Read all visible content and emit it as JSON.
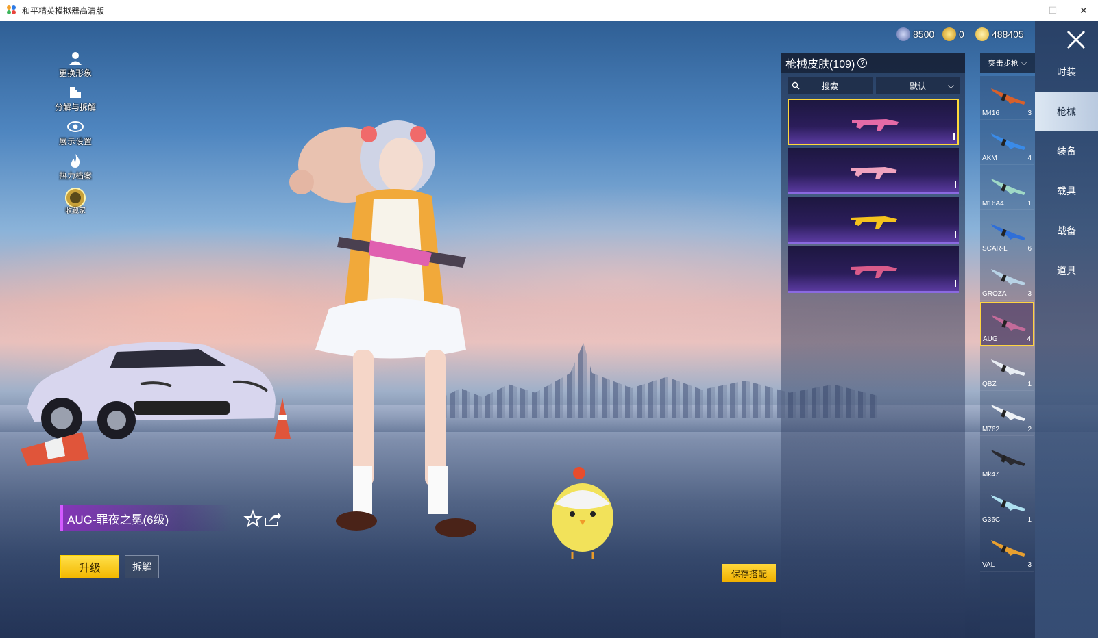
{
  "window": {
    "title": "和平精英模拟器高清版",
    "minimize_glyph": "—",
    "maximize_glyph": "☐",
    "close_glyph": "✕"
  },
  "currency": [
    {
      "icon": "globe-coin-icon",
      "value": "8500",
      "color": "#7c8cc8"
    },
    {
      "icon": "gold-token-icon",
      "value": "0",
      "color": "#f2c032"
    },
    {
      "icon": "diamond-coin-icon",
      "value": "488405",
      "color": "#f5d25a"
    }
  ],
  "left_menu": [
    {
      "icon": "avatar-icon",
      "label": "更换形象"
    },
    {
      "icon": "puzzle-icon",
      "label": "分解与拆解"
    },
    {
      "icon": "eye-icon",
      "label": "展示设置"
    },
    {
      "icon": "flame-icon",
      "label": "热力档案"
    },
    {
      "icon": "collector-badge-icon",
      "label": "收藏家"
    }
  ],
  "selected_skin": {
    "title": "AUG-罪夜之冕(6级)",
    "upgrade_label": "升级",
    "dismantle_label": "拆解",
    "save_label": "保存搭配"
  },
  "skin_panel": {
    "title": "枪械皮肤(109)",
    "help": "?",
    "search_placeholder": "搜索",
    "sort_label": "默认",
    "cards": [
      {
        "gun_color": "#e56aa6",
        "selected": true
      },
      {
        "gun_color": "#f0a3bf",
        "selected": false
      },
      {
        "gun_color": "#f5c31d",
        "selected": false
      },
      {
        "gun_color": "#d95b8a",
        "selected": false
      }
    ]
  },
  "weapon_category": "突击步枪",
  "weapons": [
    {
      "name": "M416",
      "count": "3",
      "gun_color": "#d8602a"
    },
    {
      "name": "AKM",
      "count": "4",
      "gun_color": "#3a8be8"
    },
    {
      "name": "M16A4",
      "count": "1",
      "gun_color": "#9fd9c6"
    },
    {
      "name": "SCAR-L",
      "count": "6",
      "gun_color": "#2f6fd8"
    },
    {
      "name": "GROZA",
      "count": "3",
      "gun_color": "#b8d3e6"
    },
    {
      "name": "AUG",
      "count": "4",
      "gun_color": "#c36b9a",
      "active": true
    },
    {
      "name": "QBZ",
      "count": "1",
      "gun_color": "#e8edf3"
    },
    {
      "name": "M762",
      "count": "2",
      "gun_color": "#eef2f6"
    },
    {
      "name": "Mk47",
      "count": "",
      "gun_color": "#2a2a30"
    },
    {
      "name": "G36C",
      "count": "1",
      "gun_color": "#aee0f0"
    },
    {
      "name": "VAL",
      "count": "3",
      "gun_color": "#e8a030"
    }
  ],
  "right_nav": [
    {
      "label": "时装",
      "active": false
    },
    {
      "label": "枪械",
      "active": true
    },
    {
      "label": "装备",
      "active": false
    },
    {
      "label": "载具",
      "active": false
    },
    {
      "label": "战备",
      "active": false
    },
    {
      "label": "道具",
      "active": false
    }
  ]
}
